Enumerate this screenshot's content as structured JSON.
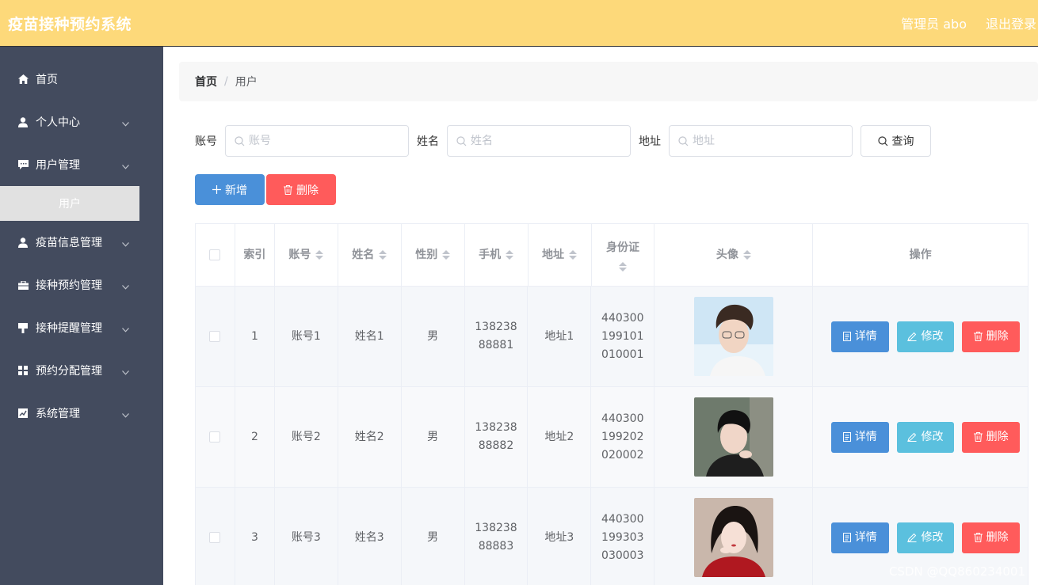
{
  "header": {
    "title": "疫苗接种预约系统",
    "user": "管理员 abo",
    "logout": "退出登录"
  },
  "sidebar": {
    "items": [
      {
        "label": "首页",
        "icon": "home-icon"
      },
      {
        "label": "个人中心",
        "icon": "user-icon"
      },
      {
        "label": "用户管理",
        "icon": "chat-icon"
      },
      {
        "label": "疫苗信息管理",
        "icon": "user-icon"
      },
      {
        "label": "接种预约管理",
        "icon": "briefcase-icon"
      },
      {
        "label": "接种提醒管理",
        "icon": "marker-icon"
      },
      {
        "label": "预约分配管理",
        "icon": "grid-icon"
      },
      {
        "label": "系统管理",
        "icon": "chart-icon"
      }
    ],
    "sub_active": "用户"
  },
  "breadcrumb": {
    "home": "首页",
    "sep": "/",
    "current": "用户"
  },
  "search": {
    "account_label": "账号",
    "account_placeholder": "账号",
    "name_label": "姓名",
    "name_placeholder": "姓名",
    "address_label": "地址",
    "address_placeholder": "地址",
    "query_label": "查询"
  },
  "actions": {
    "add_label": "新增",
    "delete_label": "删除"
  },
  "table": {
    "headers": [
      "索引",
      "账号",
      "姓名",
      "性别",
      "手机",
      "地址",
      "身份证",
      "头像",
      "操作"
    ],
    "rows": [
      {
        "index": "1",
        "account": "账号1",
        "name": "姓名1",
        "gender": "男",
        "phone": "13823888881",
        "address": "地址1",
        "idcard": "440300199101010001"
      },
      {
        "index": "2",
        "account": "账号2",
        "name": "姓名2",
        "gender": "男",
        "phone": "13823888882",
        "address": "地址2",
        "idcard": "440300199202020002"
      },
      {
        "index": "3",
        "account": "账号3",
        "name": "姓名3",
        "gender": "男",
        "phone": "13823888883",
        "address": "地址3",
        "idcard": "440300199303030003"
      }
    ],
    "ops": {
      "detail": "详情",
      "edit": "修改",
      "delete": "删除"
    }
  },
  "watermark": "CSDN @QQ860234001"
}
